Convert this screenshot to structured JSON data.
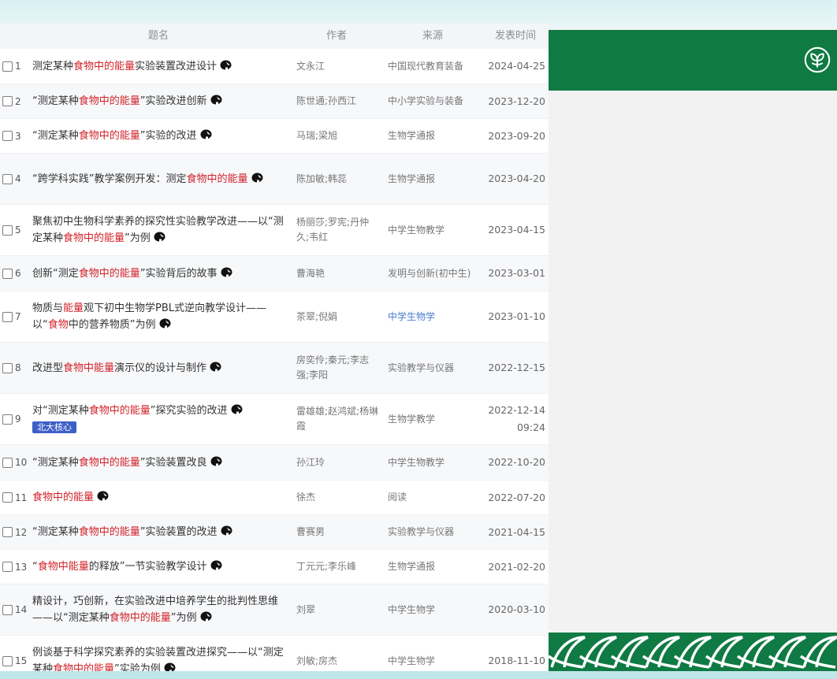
{
  "colors": {
    "highlight": "#d2232a",
    "brand_green": "#107a43",
    "tag_blue": "#3d5fc7",
    "link_blue": "#4a7bd0"
  },
  "header": {
    "title": "题名",
    "author": "作者",
    "source": "来源",
    "date": "发表时间"
  },
  "icons": {
    "download": "download-icon",
    "logo": "leaf-logo-icon"
  },
  "rows": [
    {
      "num": "1",
      "title": [
        {
          "t": "测定某种"
        },
        {
          "t": "食物中的能量",
          "hl": true
        },
        {
          "t": "实验装置改进设计"
        }
      ],
      "authors": [
        "文永江"
      ],
      "source": "中国现代教育装备",
      "date": [
        "2024-04-25"
      ],
      "h": 44
    },
    {
      "num": "2",
      "title": [
        {
          "t": "“测定某种"
        },
        {
          "t": "食物中的能量",
          "hl": true
        },
        {
          "t": "”实验改进创新"
        }
      ],
      "authors": [
        "陈世通;孙西江"
      ],
      "source": "中小学实验与装备",
      "date": [
        "2023-12-20"
      ],
      "h": 43
    },
    {
      "num": "3",
      "title": [
        {
          "t": "“测定某种"
        },
        {
          "t": "食物中的能量",
          "hl": true
        },
        {
          "t": "”实验的改进"
        }
      ],
      "authors": [
        "马瑞;梁旭"
      ],
      "source": "生物学通报",
      "date": [
        "2023-09-20"
      ],
      "h": 43
    },
    {
      "num": "4",
      "title": [
        {
          "t": "“跨学科实践”教学案例开发：测定"
        },
        {
          "t": "食物中的能量",
          "hl": true
        }
      ],
      "authors": [
        "陈加敏;韩蕊"
      ],
      "source": "生物学通报",
      "date": [
        "2023-04-20"
      ],
      "h": 64
    },
    {
      "num": "5",
      "title": [
        {
          "t": "聚焦初中生物科学素养的探究性实验教学改进——以“测定某种"
        },
        {
          "t": "食物中的能量",
          "hl": true
        },
        {
          "t": "”为例"
        }
      ],
      "authors": [
        "杨丽莎;罗宪;丹仲",
        "久;韦红"
      ],
      "source": "中学生物教学",
      "date": [
        "2023-04-15"
      ],
      "h": 64
    },
    {
      "num": "6",
      "title": [
        {
          "t": "创新“测定"
        },
        {
          "t": "食物中的能量",
          "hl": true
        },
        {
          "t": "”实验背后的故事"
        }
      ],
      "authors": [
        "曹海艳"
      ],
      "source": "发明与创新(初中生)",
      "date": [
        "2023-03-01"
      ],
      "h": 44
    },
    {
      "num": "7",
      "title": [
        {
          "t": "物质与"
        },
        {
          "t": "能量",
          "hl": true
        },
        {
          "t": "观下初中生物学PBL式逆向教学设计——以“"
        },
        {
          "t": "食物",
          "hl": true
        },
        {
          "t": "中的营养物质”为例"
        }
      ],
      "authors": [
        "茶翠;倪娟"
      ],
      "source": "中学生物学",
      "source_link": true,
      "date": [
        "2023-01-10"
      ],
      "h": 64
    },
    {
      "num": "8",
      "title": [
        {
          "t": "改进型"
        },
        {
          "t": "食物中能量",
          "hl": true
        },
        {
          "t": "演示仪的设计与制作"
        }
      ],
      "authors": [
        "房奕伶;秦元;李志",
        "强;李阳"
      ],
      "source": "实验教学与仪器",
      "date": [
        "2022-12-15"
      ],
      "h": 64
    },
    {
      "num": "9",
      "title": [
        {
          "t": "对“测定某种"
        },
        {
          "t": "食物中的能量",
          "hl": true
        },
        {
          "t": "”探究实验的改进"
        }
      ],
      "tag": "北大核心",
      "authors": [
        "雷雄雄;赵鸿斌;杨琳",
        "霞"
      ],
      "source": "生物学教学",
      "date": [
        "2022-12-14",
        "09:24"
      ],
      "h": 64
    },
    {
      "num": "10",
      "title": [
        {
          "t": "“测定某种"
        },
        {
          "t": "食物中的能量",
          "hl": true
        },
        {
          "t": "”实验装置改良"
        }
      ],
      "authors": [
        "孙江玲"
      ],
      "source": "中学生物教学",
      "date": [
        "2022-10-20"
      ],
      "h": 44
    },
    {
      "num": "11",
      "title": [
        {
          "t": "食物中的能量",
          "hl": true
        }
      ],
      "authors": [
        "徐杰"
      ],
      "source": "阅读",
      "date": [
        "2022-07-20"
      ],
      "h": 43
    },
    {
      "num": "12",
      "title": [
        {
          "t": "“测定某种"
        },
        {
          "t": "食物中的能量",
          "hl": true
        },
        {
          "t": "”实验装置的改进"
        }
      ],
      "authors": [
        "曹赛男"
      ],
      "source": "实验教学与仪器",
      "date": [
        "2021-04-15"
      ],
      "h": 43
    },
    {
      "num": "13",
      "title": [
        {
          "t": "“"
        },
        {
          "t": "食物中能量",
          "hl": true
        },
        {
          "t": "的释放”一节实验教学设计"
        }
      ],
      "authors": [
        "丁元元;李乐峰"
      ],
      "source": "生物学通报",
      "date": [
        "2021-02-20"
      ],
      "h": 43
    },
    {
      "num": "14",
      "title": [
        {
          "t": "精设计，巧创新，在实验改进中培养学生的批判性思维——以“测定某种"
        },
        {
          "t": "食物中的能量",
          "hl": true
        },
        {
          "t": "”为例"
        }
      ],
      "authors": [
        "刘翠"
      ],
      "source": "中学生物学",
      "date": [
        "2020-03-10"
      ],
      "h": 64
    },
    {
      "num": "15",
      "title": [
        {
          "t": "例谈基于科学探究素养的实验装置改进探究——以“测定某种"
        },
        {
          "t": "食物中的能量",
          "hl": true
        },
        {
          "t": "”实验为例"
        }
      ],
      "authors": [
        "刘敏;房杰"
      ],
      "source": "中学生物学",
      "date": [
        "2018-11-10"
      ],
      "h": 64
    }
  ]
}
